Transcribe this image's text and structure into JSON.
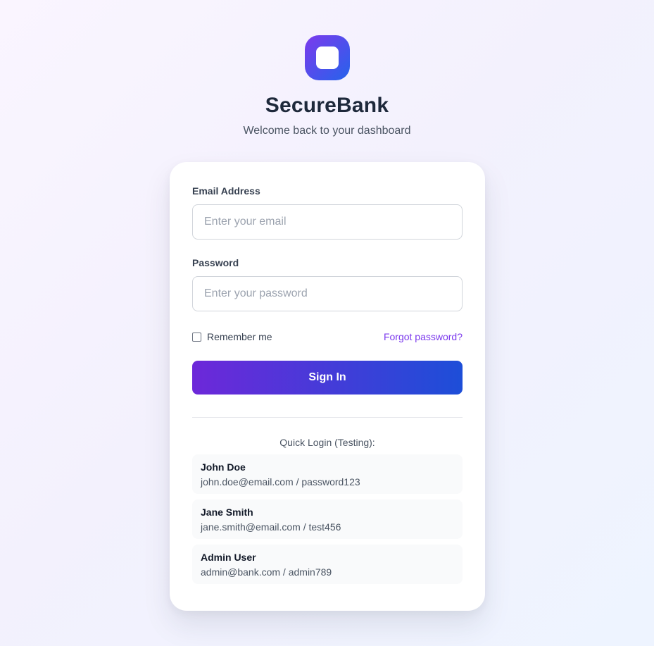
{
  "app": {
    "title": "SecureBank",
    "subtitle": "Welcome back to your dashboard",
    "logo_icon": "app-logo-icon",
    "brand_colors": [
      "#7c3aed",
      "#2563eb"
    ]
  },
  "login_form": {
    "email_label": "Email Address",
    "email_placeholder": "Enter your email",
    "email_value": "",
    "password_label": "Password",
    "password_placeholder": "Enter your password",
    "password_value": "",
    "remember_label": "Remember me",
    "remember_checked": false,
    "forgot_label": "Forgot password?",
    "submit_label": "Sign In"
  },
  "quick_login": {
    "title": "Quick Login (Testing):",
    "accounts": [
      {
        "name": "John Doe",
        "credentials": "john.doe@email.com / password123"
      },
      {
        "name": "Jane Smith",
        "credentials": "jane.smith@email.com / test456"
      },
      {
        "name": "Admin User",
        "credentials": "admin@bank.com / admin789"
      }
    ]
  }
}
